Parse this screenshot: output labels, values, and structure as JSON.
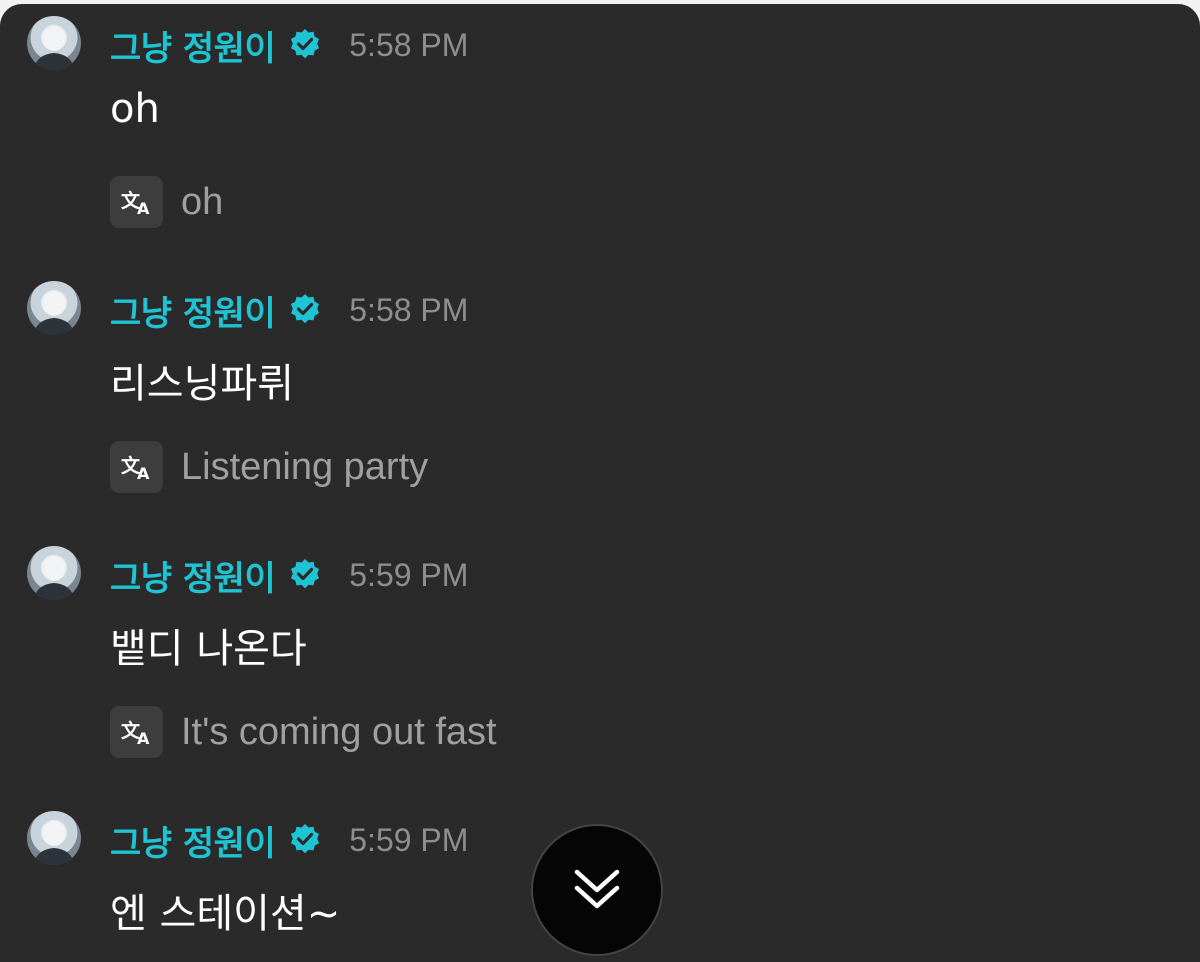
{
  "colors": {
    "username": "#1fc4d4",
    "verified_badge": "#1fc4d4",
    "background": "#2a2a2a",
    "timestamp": "#8e8e8e",
    "translation_text": "#a0a0a0"
  },
  "messages": [
    {
      "username": "그냥 정원이",
      "verified": true,
      "time": "5:58 PM",
      "text": "oh",
      "translation": "oh"
    },
    {
      "username": "그냥 정원이",
      "verified": true,
      "time": "5:58 PM",
      "text": "리스닝파뤼",
      "translation": "Listening party"
    },
    {
      "username": "그냥 정원이",
      "verified": true,
      "time": "5:59 PM",
      "text": "뱉디 나온다",
      "translation": "It's coming out fast"
    },
    {
      "username": "그냥 정원이",
      "verified": true,
      "time": "5:59 PM",
      "text": "엔 스테이션~",
      "translation": null
    }
  ],
  "icons": {
    "verified": "verified-badge-icon",
    "translate": "translate-icon",
    "scroll_down": "double-chevron-down-icon"
  }
}
